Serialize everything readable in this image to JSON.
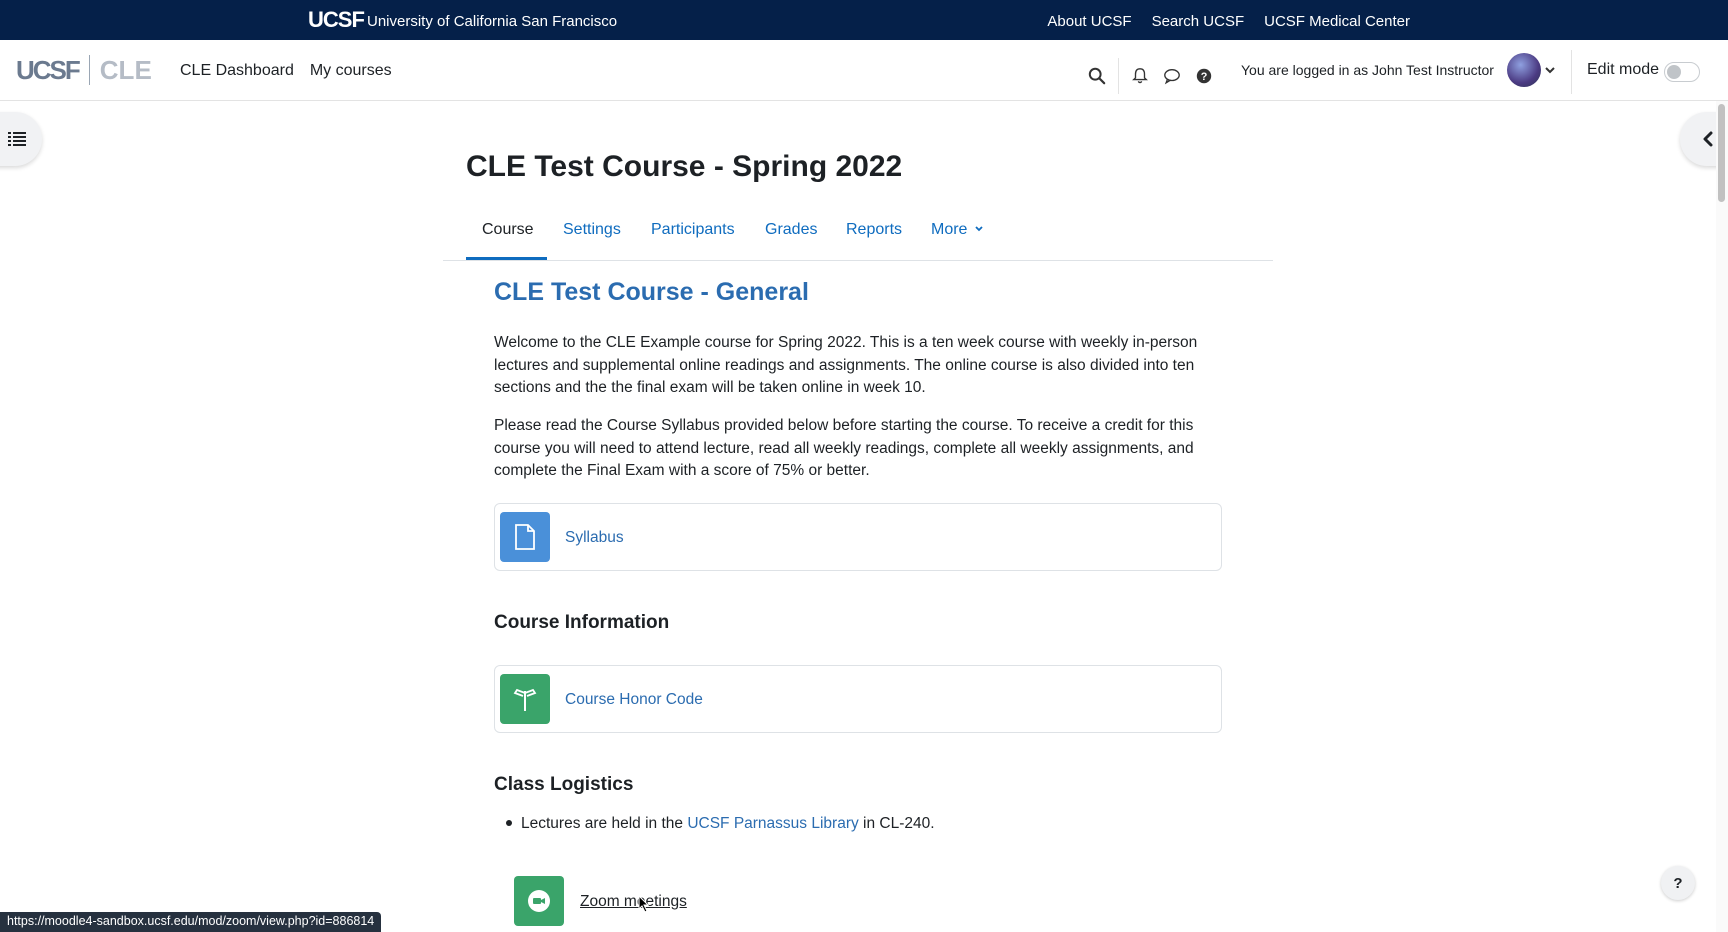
{
  "top_bar": {
    "logo_text": "UCSF",
    "university_name": "University of California San Francisco",
    "links": [
      "About UCSF",
      "Search UCSF",
      "UCSF Medical Center"
    ]
  },
  "navbar": {
    "brand_left": "UCSF",
    "brand_right": "CLE",
    "primary_links": [
      "CLE Dashboard",
      "My courses"
    ],
    "login_text": "You are logged in as John Test Instructor",
    "edit_mode_label": "Edit mode",
    "edit_mode_on": false
  },
  "course": {
    "title": "CLE Test Course - Spring 2022",
    "tabs": [
      "Course",
      "Settings",
      "Participants",
      "Grades",
      "Reports",
      "More"
    ],
    "active_tab": "Course"
  },
  "section": {
    "title": "CLE Test Course - General",
    "intro_line1": "Welcome to the CLE Example course for Spring 2022. This is a ten week course with weekly in-person",
    "intro_line2": "lectures and supplemental online readings and assignments. The online course is also divided into ten",
    "intro_line3": "sections and the the final exam will be taken online in week 10.",
    "note_line1": "Please read the Course Syllabus provided below before starting the course. To receive a credit for this",
    "note_line2": "course you will need to attend lecture, read all weekly readings, complete all weekly assignments, and",
    "note_line3": "complete the Final Exam with a score of 75% or better.",
    "syllabus_label": "Syllabus",
    "course_info_heading": "Course Information",
    "honor_code_label": "Course Honor Code",
    "logistics_heading": "Class Logistics",
    "bullet_prefix": "Lectures are held in the ",
    "bullet_link": "UCSF Parnassus Library",
    "bullet_suffix": " in CL-240.",
    "zoom_label": "Zoom meetings"
  },
  "status_url": "https://moodle4-sandbox.ucsf.edu/mod/zoom/view.php?id=886814",
  "help_label": "?",
  "colors": {
    "ucsf_navy": "#052049",
    "link_blue": "#2b6cb0",
    "syllabus_icon_bg": "#4a90d9",
    "honor_icon_bg": "#3aa46a",
    "zoom_icon_bg": "#3aa46a"
  },
  "icons": [
    "search-icon",
    "bell-icon",
    "chat-icon",
    "question-icon",
    "chevron-down-icon",
    "list-icon",
    "chevron-left-icon",
    "file-icon",
    "signpost-icon",
    "video-icon"
  ]
}
